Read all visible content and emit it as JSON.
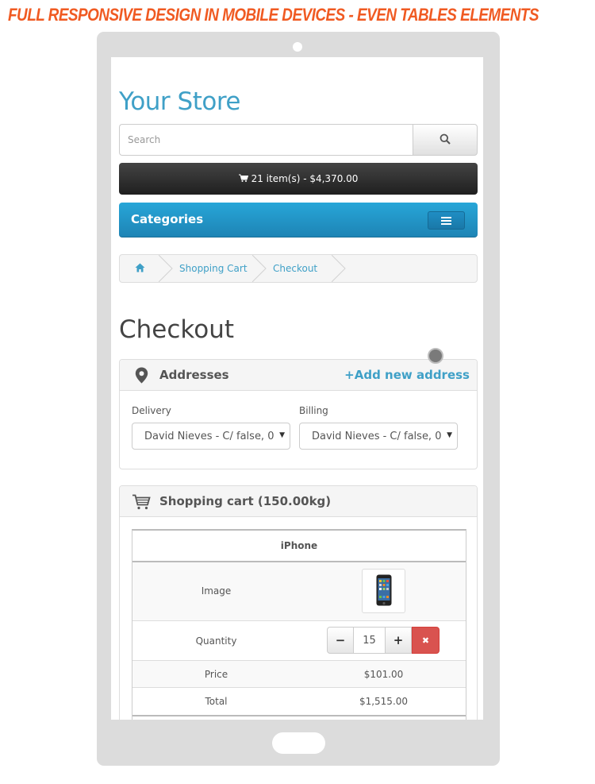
{
  "banner": {
    "text": "FULL RESPONSIVE DESIGN IN MOBILE DEVICES - EVEN TABLES ELEMENTS",
    "color": "#f05a22"
  },
  "store": {
    "name": "Your Store",
    "color": "#3fa0c7"
  },
  "search": {
    "placeholder": "Search",
    "button_icon": "search-icon"
  },
  "cart_summary": {
    "icon": "cart-icon",
    "text": "21 item(s) - $4,370.00"
  },
  "categories": {
    "label": "Categories",
    "toggle_icon": "menu-icon",
    "color": "#23a0d2"
  },
  "breadcrumb": {
    "home_icon": "home-icon",
    "items": [
      {
        "label": "Shopping Cart"
      },
      {
        "label": "Checkout"
      }
    ]
  },
  "page_title": "Checkout",
  "addresses": {
    "icon": "map-marker-icon",
    "title": "Addresses",
    "add_link": "+Add new address",
    "delivery": {
      "label": "Delivery",
      "selected": "David Nieves - C/ false, 0"
    },
    "billing": {
      "label": "Billing",
      "selected": "David Nieves - C/ false, 0"
    }
  },
  "shopping_cart": {
    "icon": "shopping-cart-icon",
    "title": "Shopping cart (150.00kg)",
    "product": {
      "name": "iPhone",
      "image_label": "Image",
      "image_icon": "iphone-icon",
      "quantity_label": "Quantity",
      "quantity": "15",
      "minus": "−",
      "plus": "+",
      "remove": "✖",
      "price_label": "Price",
      "price": "$101.00",
      "total_label": "Total",
      "total": "$1,515.00"
    }
  },
  "colors": {
    "danger": "#d9534f",
    "link": "#3fa0c7",
    "dark_bar": "#2a2a2a"
  }
}
